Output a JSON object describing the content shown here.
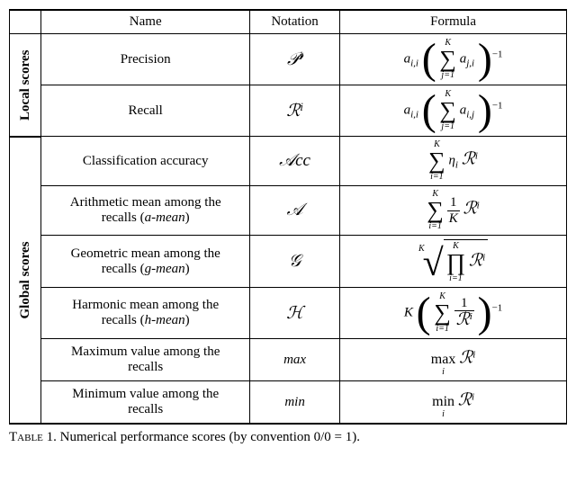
{
  "headers": {
    "blank": "",
    "name": "Name",
    "notation": "Notation",
    "formula": "Formula"
  },
  "groups": {
    "local": "Local scores",
    "global": "Global scores"
  },
  "rows": {
    "precision": {
      "name": "Precision",
      "notation": "𝒫",
      "notation_sup": "i"
    },
    "recall": {
      "name": "Recall",
      "notation": "ℛ",
      "notation_sup": "i"
    },
    "accuracy": {
      "name": "Classification accuracy",
      "notation": "𝒜cc"
    },
    "amean": {
      "name_l1": "Arithmetic mean among the",
      "name_l2": "recalls (",
      "name_em": "a-mean",
      "name_close": ")",
      "notation": "𝒜"
    },
    "gmean": {
      "name_l1": "Geometric mean among the",
      "name_l2": "recalls (",
      "name_em": "g-mean",
      "name_close": ")",
      "notation": "𝒢"
    },
    "hmean": {
      "name_l1": "Harmonic mean among the",
      "name_l2": "recalls (",
      "name_em": "h-mean",
      "name_close": ")",
      "notation": "ℋ"
    },
    "max": {
      "name_l1": "Maximum value among the",
      "name_l2": "recalls",
      "notation": "max"
    },
    "min": {
      "name_l1": "Minimum value among the",
      "name_l2": "recalls",
      "notation": "min"
    }
  },
  "formula_bits": {
    "a_ii": "a",
    "sub_ii": "i,i",
    "sub_ji": "j,i",
    "sub_ij": "i,j",
    "sum_top": "K",
    "sum_bot_j": "j=1",
    "sum_bot_i": "i=1",
    "eta": "η",
    "eta_sub": "i",
    "R": "ℛ",
    "R_sup": "i",
    "one": "1",
    "K": "K",
    "neg1": "−1",
    "max": "max",
    "min": "min",
    "sub_i": "i"
  },
  "caption_label": "Table 1.",
  "caption_text": "Numerical performance scores (by convention 0/0 = 1)."
}
